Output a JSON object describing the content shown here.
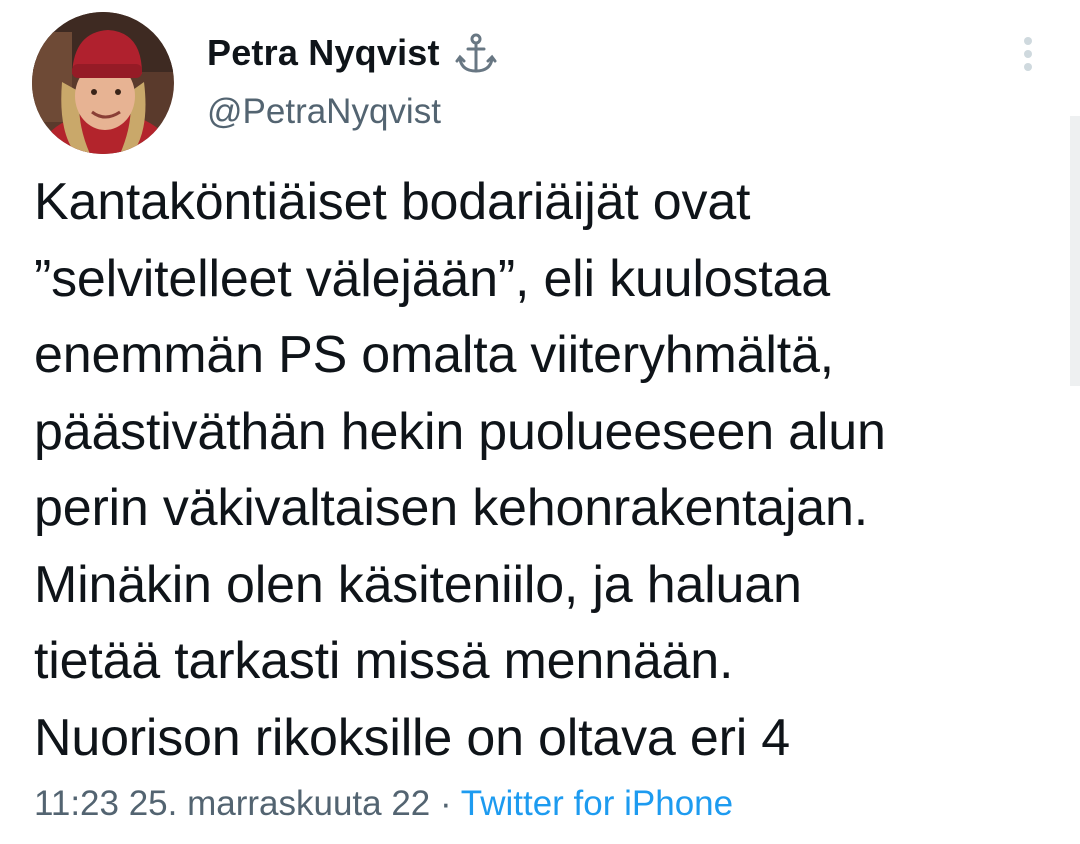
{
  "author": {
    "display_name": "Petra Nyqvist",
    "badge_icon": "anchor-icon",
    "handle": "@PetraNyqvist",
    "avatar_icon": "avatar"
  },
  "menu_icon": "more-vertical-icon",
  "tweet": {
    "lines": [
      "Kantaköntiäiset bodariäijät ovat",
      "”selvitelleet välejään”, eli kuulostaa",
      "enemmän PS omalta viiteryhmältä,",
      "päästiväthän hekin puolueeseen alun",
      "perin väkivaltaisen kehonrakentajan.",
      "Minäkin olen käsiteniilo, ja haluan",
      "tietää tarkasti missä mennään.",
      "Nuorison rikoksille on oltava eri 4"
    ]
  },
  "meta": {
    "time": "11:23 25. marraskuuta 22",
    "separator": " · ",
    "source": "Twitter for iPhone"
  },
  "colors": {
    "text": "#0f1419",
    "secondary": "#536471",
    "link": "#1d9bf0"
  }
}
